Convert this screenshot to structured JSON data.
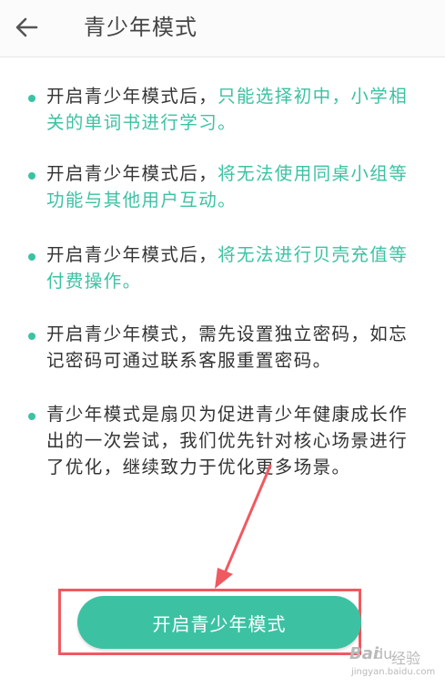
{
  "header": {
    "title": "青少年模式",
    "back_icon": "arrow-left-icon"
  },
  "colors": {
    "accent": "#3cc2a3",
    "text": "#333333",
    "annotation": "#ef5a60"
  },
  "items": [
    {
      "text": "开启青少年模式后，",
      "highlight": "只能选择初中，小学相关的单词书进行学习。"
    },
    {
      "text": "开启青少年模式后，",
      "highlight": "将无法使用同桌小组等功能与其他用户互动。"
    },
    {
      "text": "开启青少年模式后，",
      "highlight": "将无法进行贝壳充值等付费操作。"
    },
    {
      "text": "开启青少年模式，需先设置独立密码，如忘记密码可通过联系客服重置密码。",
      "highlight": ""
    },
    {
      "text": "青少年模式是扇贝为促进青少年健康成长作出的一次尝试，我们优先针对核心场景进行了优化，继续致力于优化更多场景。",
      "highlight": ""
    }
  ],
  "cta": {
    "label": "开启青少年模式"
  },
  "watermark": {
    "brand": "Bai",
    "paw": "du",
    "word": "经验",
    "url": "jingyan.baidu.com"
  }
}
